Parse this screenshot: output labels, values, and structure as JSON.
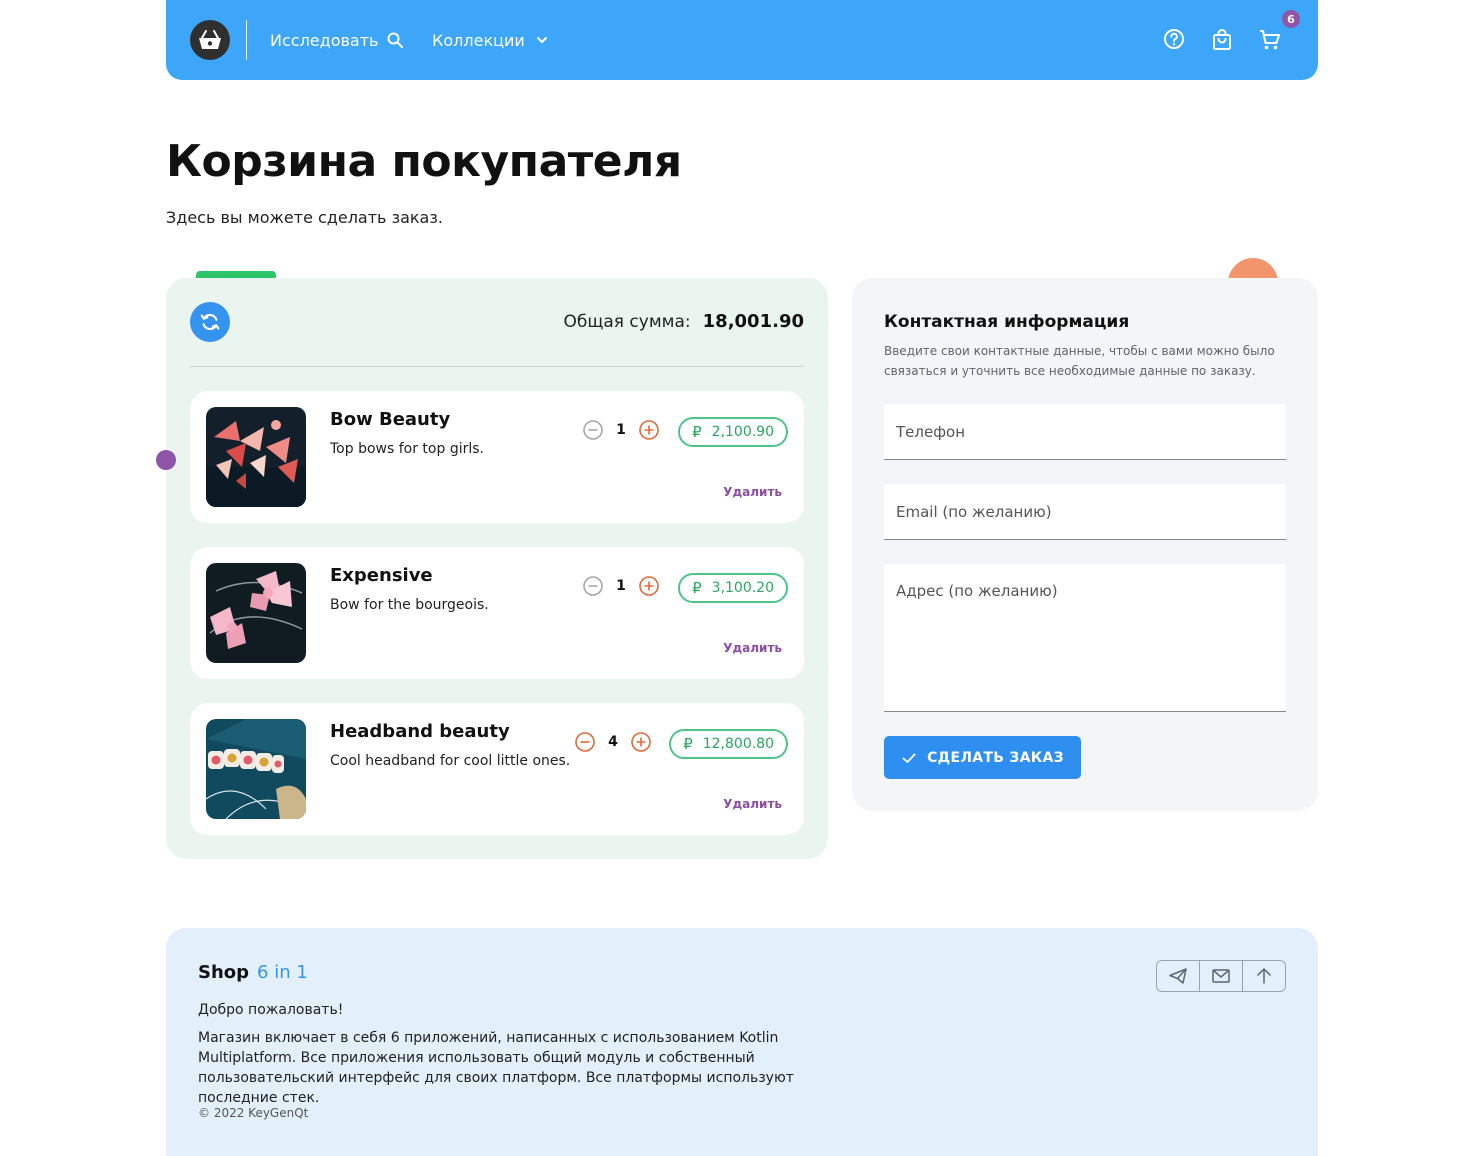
{
  "header": {
    "nav": [
      {
        "label": "Исследовать",
        "icon": "search-icon"
      },
      {
        "label": "Коллекции",
        "icon": "chevron-down-icon"
      }
    ],
    "cart_badge": "6",
    "colors": {
      "bar": "#3ea6f8",
      "badge": "#9155a7"
    }
  },
  "page": {
    "title": "Корзина покупателя",
    "subtitle": "Здесь вы можете сделать заказ."
  },
  "cart": {
    "total_label": "Общая сумма:",
    "total_value": "18,001.90",
    "currency_symbol": "₽",
    "items": [
      {
        "name": "Bow Beauty",
        "description": "Top bows for top girls.",
        "quantity": "1",
        "price": "2,100.90",
        "remove_label": "Удалить"
      },
      {
        "name": "Expensive",
        "description": "Bow for the bourgeois.",
        "quantity": "1",
        "price": "3,100.20",
        "remove_label": "Удалить"
      },
      {
        "name": "Headband beauty",
        "description": "Cool headband for cool little ones.",
        "quantity": "4",
        "price": "12,800.80",
        "remove_label": "Удалить"
      }
    ]
  },
  "contact": {
    "title": "Контактная информация",
    "description": "Введите свои контактные данные, чтобы с вами можно было связаться и уточнить все необходимые данные по заказу.",
    "phone_placeholder": "Телефон",
    "email_placeholder": "Email (по желанию)",
    "address_placeholder": "Адрес (по желанию)",
    "submit_label": "СДЕЛАТЬ ЗАКАЗ"
  },
  "footer": {
    "brand": "Shop",
    "brand_tag": "6 in 1",
    "welcome": "Добро пожаловать!",
    "text": "Магазин включает в себя 6 приложений, написанных с использованием Kotlin Multiplatform. Все приложения использовать общий модуль и собственный пользовательский интерфейс для своих платформ. Все платформы используют последние стек.",
    "copyright": "© 2022 KeyGenQt",
    "actions": [
      "telegram-icon",
      "mail-icon",
      "arrow-up-icon"
    ]
  }
}
